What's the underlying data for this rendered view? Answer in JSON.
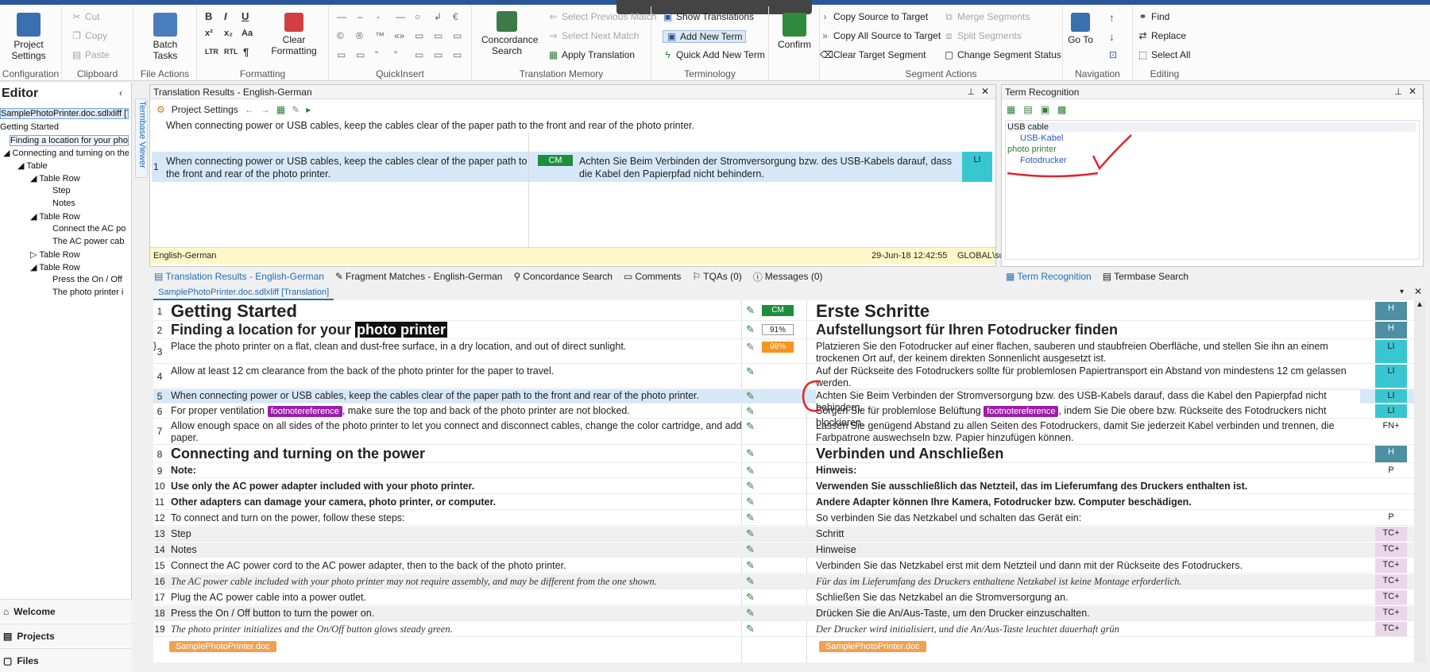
{
  "ribbon": {
    "groups": {
      "configuration": {
        "label": "Configuration",
        "button": "Project Settings"
      },
      "clipboard": {
        "label": "Clipboard",
        "cut": "Cut",
        "copy": "Copy",
        "paste": "Paste"
      },
      "file_actions": {
        "label": "File Actions",
        "button": "Batch Tasks"
      },
      "formatting": {
        "label": "Formatting",
        "clear": "Clear Formatting"
      },
      "quickinsert": {
        "label": "QuickInsert"
      },
      "translation_memory": {
        "label": "Translation Memory",
        "concordance": "Concordance Search",
        "prev_match": "Select Previous Match",
        "next_match": "Select Next Match",
        "apply": "Apply Translation"
      },
      "terminology": {
        "label": "Terminology",
        "show": "Show Translations",
        "add": "Add New Term",
        "quick_add": "Quick Add New Term"
      },
      "confirm": {
        "label": "Confirm"
      },
      "segment_actions": {
        "label": "Segment Actions",
        "copy_src": "Copy Source to Target",
        "copy_all": "Copy All Source to Target",
        "clear_target": "Clear Target Segment",
        "merge": "Merge Segments",
        "split": "Split Segments",
        "change_status": "Change Segment Status"
      },
      "navigation": {
        "label": "Navigation",
        "goto": "Go To"
      },
      "editing": {
        "label": "Editing",
        "find": "Find",
        "replace": "Replace",
        "select_all": "Select All"
      }
    }
  },
  "left": {
    "title": "Editor",
    "file": "SamplePhotoPrinter.doc.sdlxliff [T",
    "tree": [
      "Getting Started",
      "Finding a location for your pho",
      "Connecting and turning on the",
      "Table",
      "Table Row",
      "Step",
      "Notes",
      "Table Row",
      "Connect the AC po",
      "The AC power cab",
      "Table Row",
      "Table Row",
      "Press the On / Off",
      "The photo printer i"
    ],
    "nav": {
      "welcome": "Welcome",
      "projects": "Projects",
      "files": "Files"
    }
  },
  "translation_results": {
    "title": "Translation Results - English-German",
    "project_settings": "Project Settings",
    "source_line": "When connecting power or USB cables, keep the cables clear of the paper path to the front and rear of the photo printer.",
    "match_src": "When connecting power or USB cables, keep the cables clear of the paper path to the front and rear of the photo printer.",
    "match_tgt": "Achten Sie Beim Verbinden der Stromversorgung bzw. des USB-Kabels darauf, dass die Kabel den Papierpfad nicht behindern.",
    "match_num": "1",
    "match_status": "CM",
    "match_tag": "LI",
    "lang": "English-German",
    "date": "29-Jun-18 12:42:55",
    "user": "GLOBAL\\suricariu",
    "vertical_tab": "Termbase Viewer"
  },
  "term_recognition": {
    "title": "Term Recognition",
    "terms": [
      {
        "src": "USB cable",
        "tgt": "USB-Kabel"
      },
      {
        "src": "photo printer",
        "tgt": "Fotodrucker"
      }
    ]
  },
  "bottom_tabs": {
    "left": [
      "Translation Results - English-German",
      "Fragment Matches - English-German",
      "Concordance Search",
      "Comments",
      "TQAs (0)",
      "Messages (0)"
    ],
    "right": [
      "Term Recognition",
      "Termbase Search"
    ]
  },
  "editor_doc_tab": "SamplePhotoPrinter.doc.sdlxliff [Translation]",
  "segments": [
    {
      "n": "1",
      "src": "Getting Started",
      "tgt": "Erste Schritte",
      "status": "CM",
      "tag": "H",
      "style": "h1"
    },
    {
      "n": "2",
      "src_pre": "Finding a location for your ",
      "src_hl": "photo printer",
      "tgt": "Aufstellungsort für Ihren Fotodrucker finden",
      "status": "91%",
      "tag": "H",
      "style": "h2"
    },
    {
      "n": "3",
      "src": "Place the photo printer on a flat, clean and dust-free surface, in a dry location, and out of direct sunlight.",
      "tgt": "Platzieren Sie den Fotodrucker auf einer flachen, sauberen und staubfreien Oberfläche, und stellen Sie ihn an einem trockenen Ort auf, der keinem direkten Sonnenlicht ausgesetzt ist.",
      "status": "98%",
      "tag": "LI"
    },
    {
      "n": "4",
      "src": "Allow at least 12 cm clearance from the back of the photo printer for the paper to travel.",
      "tgt": "Auf der Rückseite des Fotodruckers sollte für problemlosen Papiertransport ein Abstand von mindestens 12 cm gelassen werden.",
      "tag": "LI"
    },
    {
      "n": "5",
      "src": "When connecting power or USB cables, keep the cables clear of the paper path to the front and rear of the photo printer.",
      "tgt": "Achten Sie Beim Verbinden der Stromversorgung bzw. des USB-Kabels darauf, dass die Kabel den Papierpfad nicht behindern.",
      "tag": "LI"
    },
    {
      "n": "6",
      "src_pre": "For proper ventilation ",
      "src_chip": "footnotereference",
      "src_post": ", make sure the top and back of the photo printer are not blocked.",
      "tgt_pre": "Sorgen Sie für problemlose Belüftung ",
      "tgt_chip": "footnotereference",
      "tgt_post": ", indem Sie Die obere bzw. Rückseite des Fotodruckers nicht blockieren.",
      "tag": "LI"
    },
    {
      "n": "7",
      "src": "Allow enough space on all sides of the photo printer to let you connect and disconnect cables, change the color cartridge, and add paper.",
      "tgt": "Lassen Sie genügend Abstand zu allen Seiten des Fotodruckers, damit Sie jederzeit Kabel verbinden und trennen, die Farbpatrone auswechseln bzw. Papier hinzufügen können.",
      "tag": "FN+"
    },
    {
      "n": "8",
      "src": "Connecting and turning on the power",
      "tgt": "Verbinden und Anschließen",
      "tag": "H",
      "style": "h2"
    },
    {
      "n": "9",
      "src": "Note:",
      "tgt": "Hinweis:",
      "tag": "P",
      "style": "bold"
    },
    {
      "n": "10",
      "src": "Use only the AC power adapter included with your photo printer.",
      "tgt": "Verwenden Sie ausschließlich das Netzteil, das im Lieferumfang des Druckers enthalten ist.",
      "style": "bold"
    },
    {
      "n": "11",
      "src": "Other adapters can damage your camera, photo printer, or computer.",
      "tgt": "Andere Adapter können Ihre Kamera, Fotodrucker bzw. Computer beschädigen.",
      "style": "bold"
    },
    {
      "n": "12",
      "src": "To connect and turn on the power, follow these steps:",
      "tgt": "So verbinden Sie das Netzkabel und schalten das Gerät ein:",
      "tag": "P"
    },
    {
      "n": "13",
      "src": "Step",
      "tgt": "Schritt",
      "tag": "TC+"
    },
    {
      "n": "14",
      "src": "Notes",
      "tgt": "Hinweise",
      "tag": "TC+"
    },
    {
      "n": "15",
      "src": "Connect the AC power cord to the AC power adapter, then to the back of the photo printer.",
      "tgt": "Verbinden Sie das Netzkabel erst mit dem Netzteil und dann mit der Rückseite des Fotodruckers.",
      "tag": "TC+"
    },
    {
      "n": "16",
      "src": "The AC power cable included with your photo printer may not require assembly, and may be different from the one shown.",
      "tgt": "Für das im Lieferumfang des Druckers enthaltene Netzkabel ist keine Montage erforderlich.",
      "tag": "TC+",
      "style": "italic"
    },
    {
      "n": "17",
      "src": "Plug the AC power cable into a power outlet.",
      "tgt": "Schließen Sie das Netzkabel an die Stromversorgung an.",
      "tag": "TC+"
    },
    {
      "n": "18",
      "src": "Press the On / Off button to turn the power on.",
      "tgt": "Drücken Sie die An/Aus-Taste, um den Drucker einzuschalten.",
      "tag": "TC+"
    },
    {
      "n": "19",
      "src": "The photo printer initializes and the On/Off button glows steady green.",
      "tgt": "Der Drucker wird initialisiert, und die An/Aus-Taste leuchtet dauerhaft grün",
      "tag": "TC+",
      "style": "italic"
    }
  ],
  "file_chip": "SamplePhotoPrinter.doc",
  "colors": {
    "accent": "#2b579a",
    "tag_cyan": "#38c7d0",
    "tag_h": "#4d8fa3",
    "tag_tc": "#ead7ea",
    "chip_purple": "#9c1ea8"
  }
}
